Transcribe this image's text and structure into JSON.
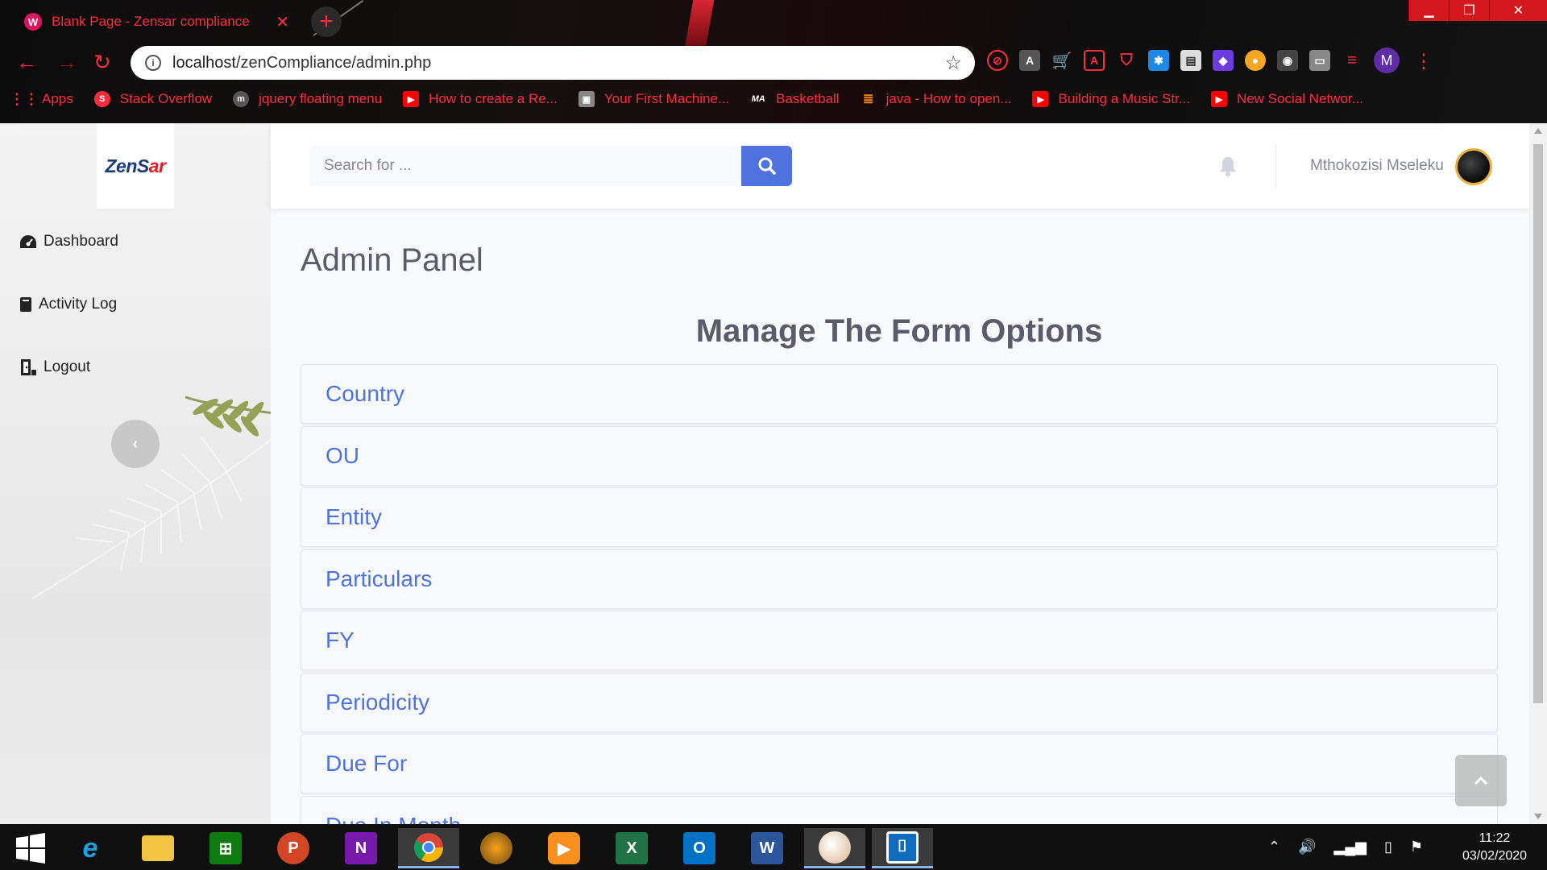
{
  "browser": {
    "tab_title": "Blank Page - Zensar compliance",
    "tab_favicon": "W",
    "url_host": "localhost",
    "url_path": "/zenCompliance/admin.php",
    "profile_initial": "M",
    "bookmarks": [
      {
        "label": "Apps",
        "icon": "apps-grid-icon"
      },
      {
        "label": "Stack Overflow",
        "icon": "stackoverflow-icon"
      },
      {
        "label": "jquery floating menu",
        "icon": "m-logo-icon"
      },
      {
        "label": "How to create a Re...",
        "icon": "youtube-icon"
      },
      {
        "label": "Your First Machine...",
        "icon": "page-thumbnail-icon"
      },
      {
        "label": "Basketball",
        "icon": "ma-logo-icon"
      },
      {
        "label": "java - How to open...",
        "icon": "stackoverflow-icon"
      },
      {
        "label": "Building a Music Str...",
        "icon": "youtube-icon"
      },
      {
        "label": "New Social Networ...",
        "icon": "youtube-icon"
      }
    ]
  },
  "sidebar": {
    "logo_left": "ZenS",
    "logo_right": "ar",
    "items": [
      {
        "label": "Dashboard",
        "icon": "tachometer-icon"
      },
      {
        "label": "Activity Log",
        "icon": "book-icon"
      },
      {
        "label": "Logout",
        "icon": "door-exit-icon"
      }
    ]
  },
  "topbar": {
    "search_placeholder": "Search for ...",
    "username": "Mthokozisi Mseleku"
  },
  "main": {
    "page_title": "Admin Panel",
    "section_title": "Manage The Form Options",
    "options": [
      "Country",
      "OU",
      "Entity",
      "Particulars",
      "FY",
      "Periodicity",
      "Due For",
      "Due In Month"
    ]
  },
  "taskbar": {
    "time": "11:22",
    "date": "03/02/2020"
  },
  "colors": {
    "primary": "#4e73df",
    "text_gray": "#5a5c69",
    "chrome_accent": "#ff2b3d"
  }
}
